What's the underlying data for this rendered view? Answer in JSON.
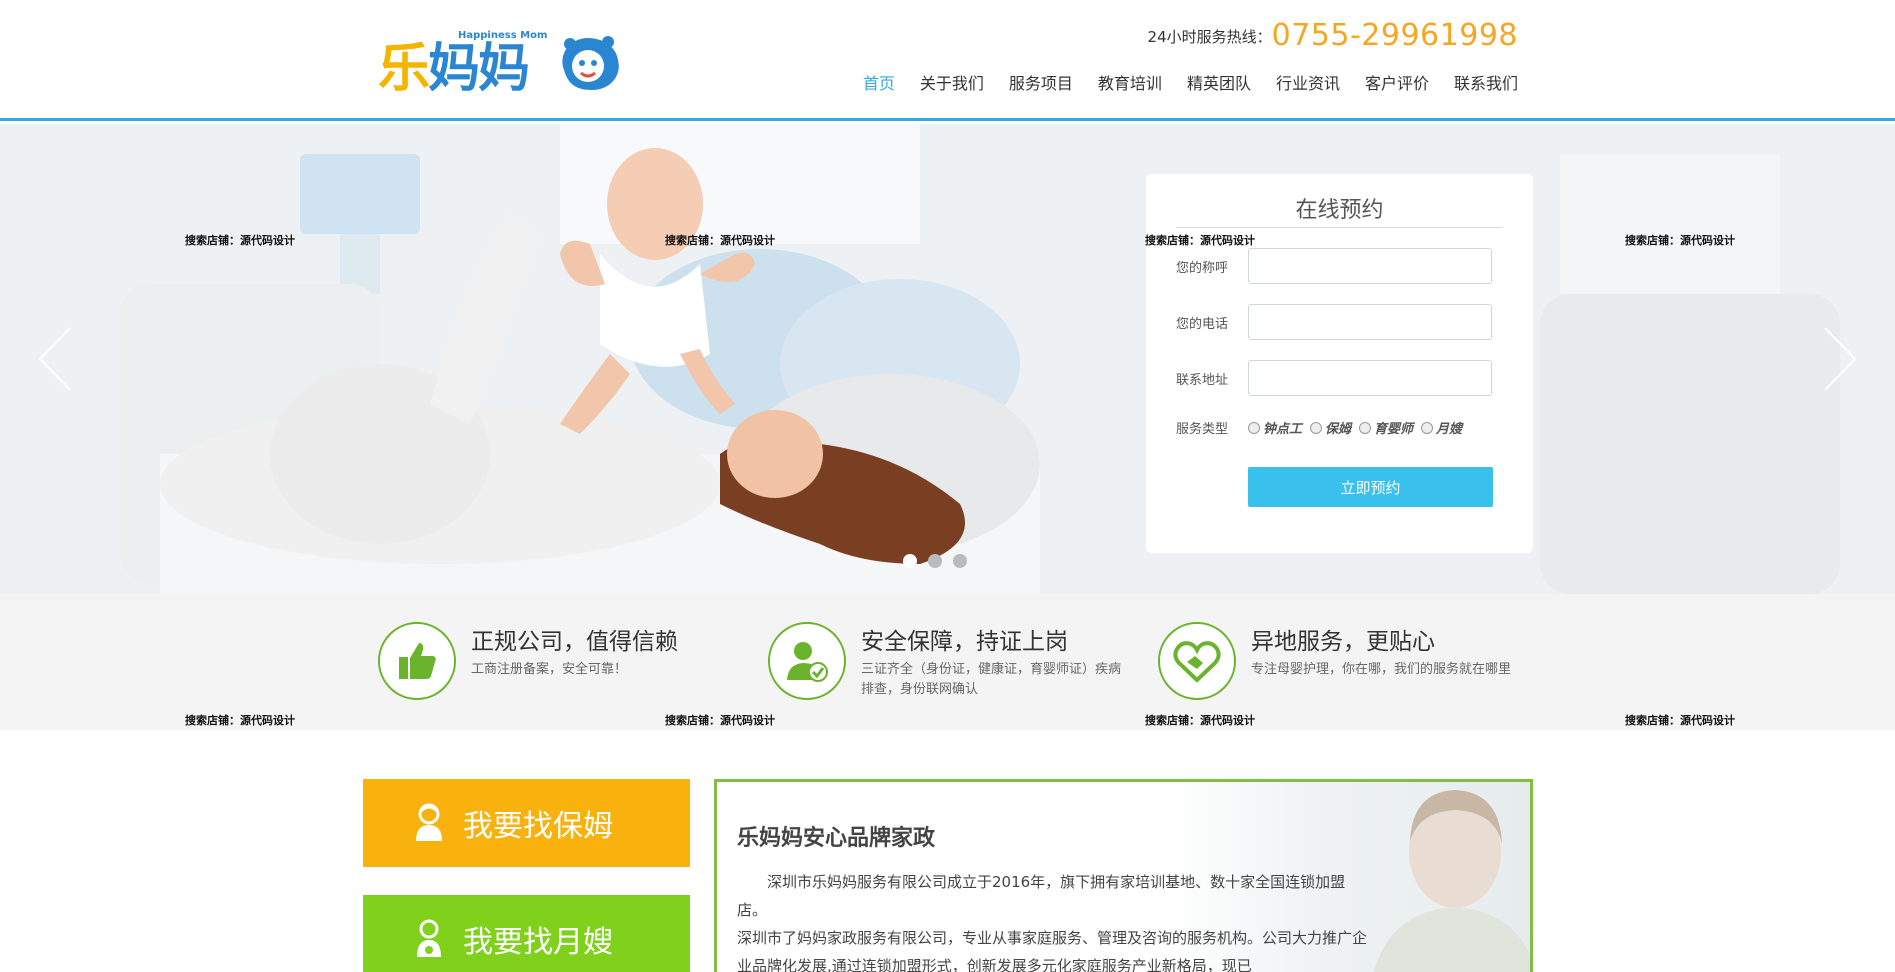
{
  "header": {
    "logo_char1": "乐",
    "logo_char2": "妈妈",
    "logo_sub": "Happiness Mom",
    "hotline_label": "24小时服务热线：",
    "hotline_number": "0755-29961998",
    "nav": [
      {
        "label": "首页",
        "active": true
      },
      {
        "label": "关于我们"
      },
      {
        "label": "服务项目"
      },
      {
        "label": "教育培训"
      },
      {
        "label": "精英团队"
      },
      {
        "label": "行业资讯"
      },
      {
        "label": "客户评价"
      },
      {
        "label": "联系我们"
      }
    ]
  },
  "banner": {
    "slide_count": 3,
    "active_slide": 1
  },
  "booking": {
    "title": "在线预约",
    "name_label": "您的称呼",
    "phone_label": "您的电话",
    "address_label": "联系地址",
    "type_label": "服务类型",
    "types": [
      "钟点工",
      "保姆",
      "育婴师",
      "月嫂"
    ],
    "submit_label": "立即预约"
  },
  "features": [
    {
      "title": "正规公司，值得信赖",
      "desc": "工商注册备案，安全可靠！"
    },
    {
      "title": "安全保障，持证上岗",
      "desc": "三证齐全（身份证，健康证，育婴师证）疾病排查，身份联网确认"
    },
    {
      "title": "异地服务，更贴心",
      "desc": "专注母婴护理，你在哪，我们的服务就在哪里"
    }
  ],
  "cta": {
    "nanny_label": "我要找保姆",
    "yuesao_label": "我要找月嫂"
  },
  "intro": {
    "title": "乐妈妈安心品牌家政",
    "p1": "深圳市乐妈妈服务有限公司成立于2016年，旗下拥有家培训基地、数十家全国连锁加盟店。",
    "p2": "深圳市了妈妈家政服务有限公司，专业从事家庭服务、管理及咨询的服务机构。公司大力推广企业品牌化发展,通过连锁加盟形式，创新发展多元化家庭服务产业新格局，现已"
  },
  "watermark": "搜索店铺：源代码设计",
  "colors": {
    "accent_blue": "#36a9e1",
    "hotline_orange": "#f5a623",
    "feature_green": "#6ab42d",
    "cta_yellow": "#f9b20d",
    "cta_green": "#7fd11c",
    "submit_blue": "#39c0ed"
  }
}
